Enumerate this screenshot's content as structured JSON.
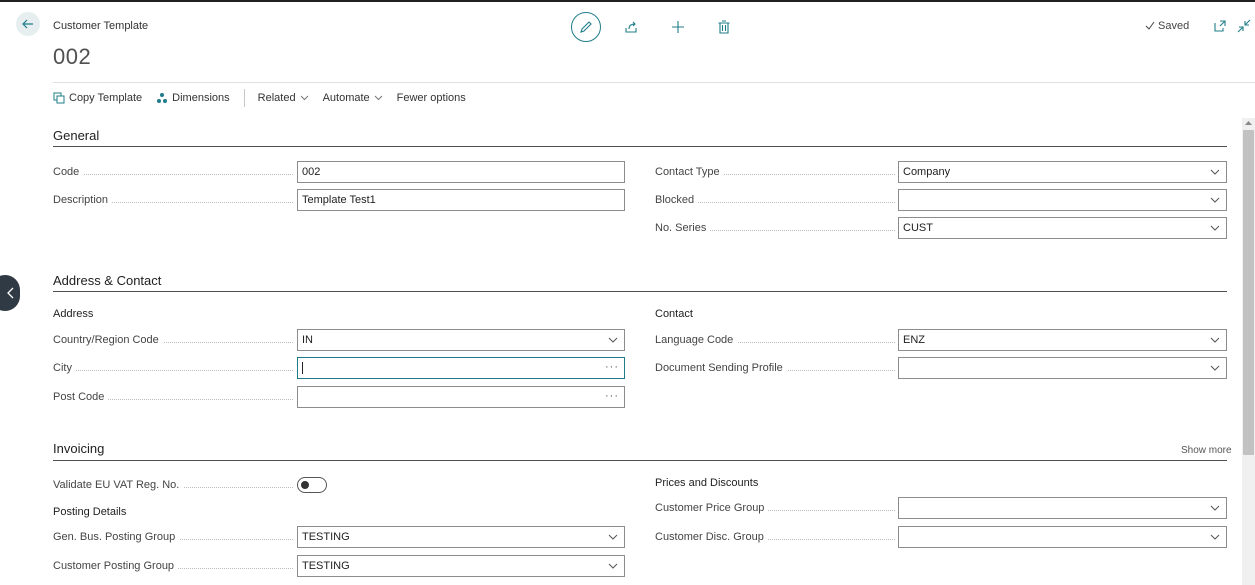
{
  "header": {
    "caption": "Customer Template",
    "title": "002",
    "status": "Saved"
  },
  "actions": {
    "copy_template": "Copy Template",
    "dimensions": "Dimensions",
    "related": "Related",
    "automate": "Automate",
    "fewer_options": "Fewer options"
  },
  "general": {
    "title": "General",
    "code": {
      "label": "Code",
      "value": "002"
    },
    "description": {
      "label": "Description",
      "value": "Template Test1"
    },
    "contact_type": {
      "label": "Contact Type",
      "value": "Company"
    },
    "blocked": {
      "label": "Blocked",
      "value": ""
    },
    "no_series": {
      "label": "No. Series",
      "value": "CUST"
    }
  },
  "address_contact": {
    "title": "Address & Contact",
    "address_group": "Address",
    "contact_group": "Contact",
    "country": {
      "label": "Country/Region Code",
      "value": "IN"
    },
    "city": {
      "label": "City",
      "value": ""
    },
    "post_code": {
      "label": "Post Code",
      "value": ""
    },
    "language": {
      "label": "Language Code",
      "value": "ENZ"
    },
    "doc_sending": {
      "label": "Document Sending Profile",
      "value": ""
    }
  },
  "invoicing": {
    "title": "Invoicing",
    "show_more": "Show more",
    "validate_vat": {
      "label": "Validate EU VAT Reg. No.",
      "value": false
    },
    "posting_details": "Posting Details",
    "gen_bus": {
      "label": "Gen. Bus. Posting Group",
      "value": "TESTING"
    },
    "cust_posting": {
      "label": "Customer Posting Group",
      "value": "TESTING"
    },
    "prices_discounts": "Prices and Discounts",
    "price_group": {
      "label": "Customer Price Group",
      "value": ""
    },
    "disc_group": {
      "label": "Customer Disc. Group",
      "value": ""
    }
  },
  "theme": {
    "accent": "#1f7d8a",
    "handle": "#303a44"
  }
}
